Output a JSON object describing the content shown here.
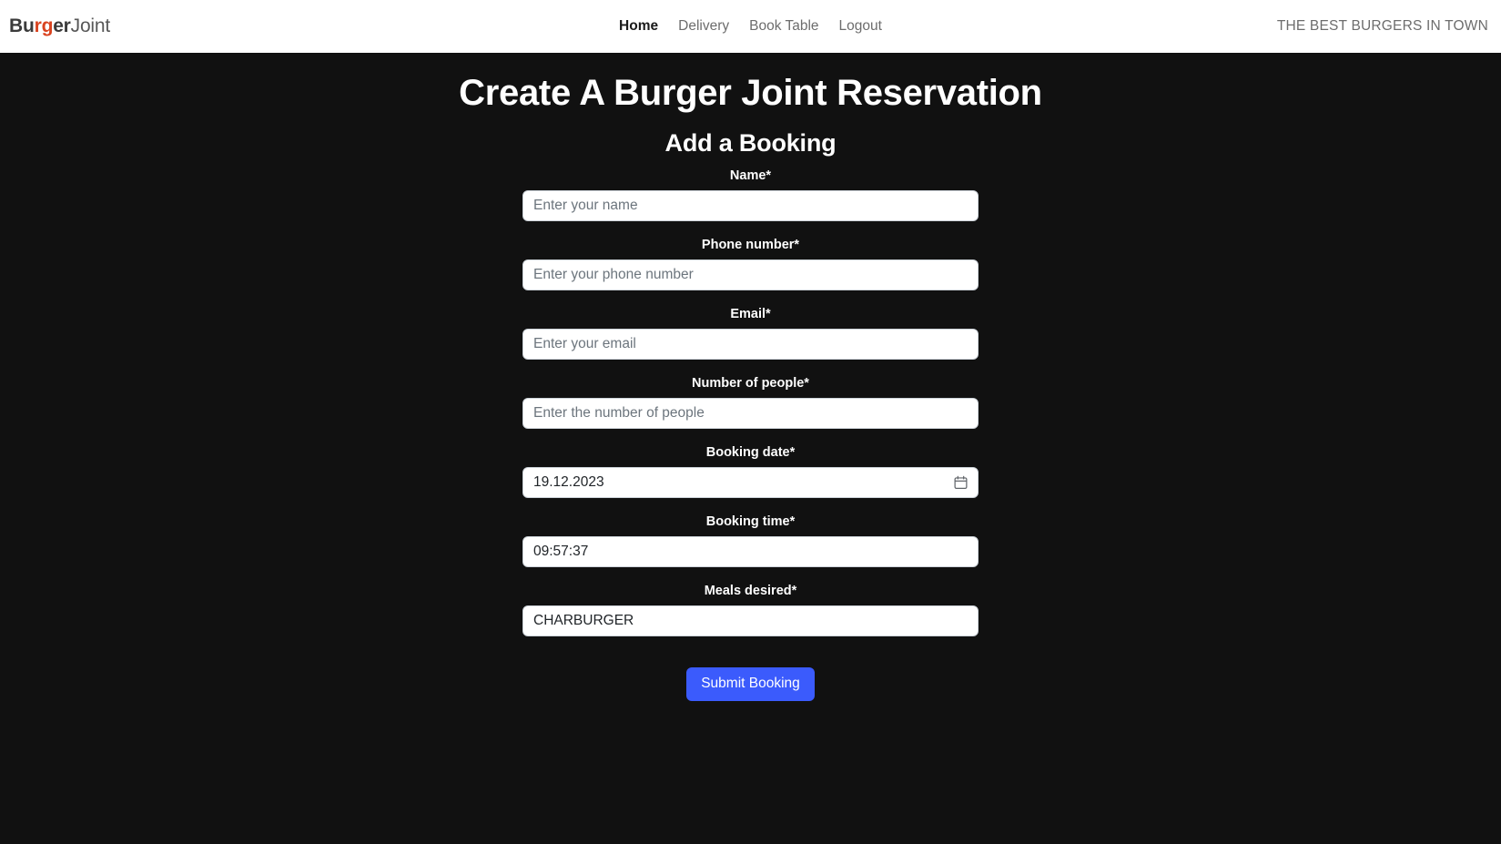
{
  "header": {
    "brand": {
      "part_dark_1": "Bu",
      "part_accent": "rg",
      "part_dark_2": "er",
      "part_light": "Joint"
    },
    "nav": [
      {
        "label": "Home",
        "active": true
      },
      {
        "label": "Delivery",
        "active": false
      },
      {
        "label": "Book Table",
        "active": false
      },
      {
        "label": "Logout",
        "active": false
      }
    ],
    "tagline": "THE BEST BURGERS IN TOWN"
  },
  "main": {
    "page_title": "Create A Burger Joint Reservation",
    "form_title": "Add a Booking",
    "fields": [
      {
        "label": "Name*",
        "placeholder": "Enter your name",
        "value": ""
      },
      {
        "label": "Phone number*",
        "placeholder": "Enter your phone number",
        "value": ""
      },
      {
        "label": "Email*",
        "placeholder": "Enter your email",
        "value": ""
      },
      {
        "label": "Number of people*",
        "placeholder": "Enter the number of people",
        "value": ""
      },
      {
        "label": "Booking date*",
        "placeholder": "",
        "value": "19.12.2023"
      },
      {
        "label": "Booking time*",
        "placeholder": "",
        "value": "09:57:37"
      },
      {
        "label": "Meals desired*",
        "placeholder": "",
        "value": "CHARBURGER"
      }
    ],
    "submit_label": "Submit Booking"
  },
  "colors": {
    "brand_accent": "#d9431f",
    "background": "#111111",
    "submit_button": "#3b5bfc",
    "header_background": "#ffffff"
  }
}
